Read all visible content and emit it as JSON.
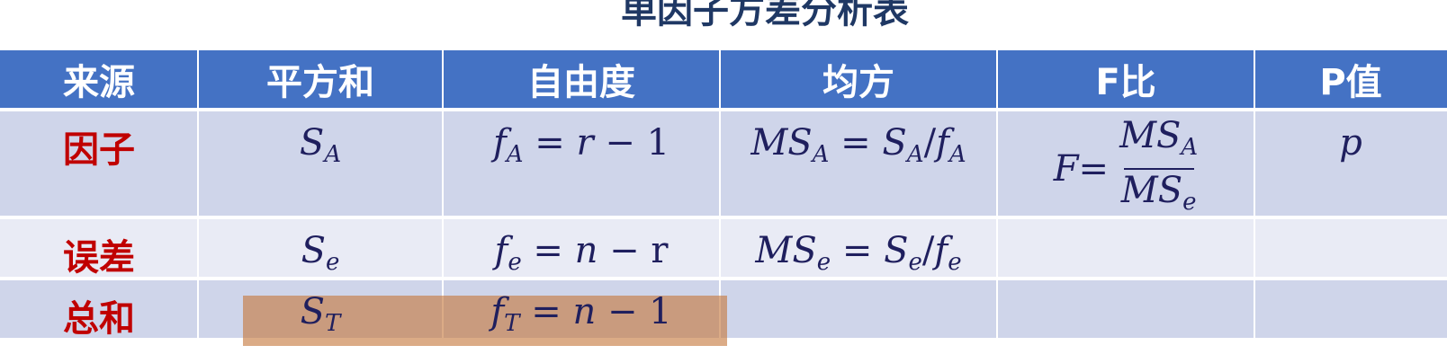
{
  "title": "单因子方差分析表",
  "headers": [
    "来源",
    "平方和",
    "自由度",
    "均方",
    "F比",
    "P值"
  ],
  "rows": [
    {
      "source": "因子",
      "sum_sq": {
        "base": "S",
        "sub": "A"
      },
      "df": {
        "lhs_base": "f",
        "lhs_sub": "A",
        "eq": " = ",
        "rhs_var": "r",
        "rhs_rest": " − 1"
      },
      "ms": {
        "b1": "MS",
        "s1": "A",
        "eq": " = ",
        "b2": "S",
        "s2": "A",
        "slash": "/",
        "b3": "f",
        "s3": "A"
      },
      "f_ratio": {
        "lhs": "F",
        "eq": " = ",
        "num_base": "MS",
        "num_sub": "A",
        "den_base": "MS",
        "den_sub": "e"
      },
      "p_value": "p"
    },
    {
      "source": "误差",
      "sum_sq": {
        "base": "S",
        "sub": "e"
      },
      "df": {
        "lhs_base": "f",
        "lhs_sub": "e",
        "eq": " = ",
        "rhs_var": "n",
        "rhs_rest": " − r"
      },
      "ms": {
        "b1": "MS",
        "s1": "e",
        "eq": " = ",
        "b2": "S",
        "s2": "e",
        "slash": "/",
        "b3": "f",
        "s3": "e"
      }
    },
    {
      "source": "总和",
      "sum_sq": {
        "base": "S",
        "sub": "T"
      },
      "df": {
        "lhs_base": "f",
        "lhs_sub": "T",
        "eq": " = ",
        "rhs_var": "n",
        "rhs_rest": " − 1"
      }
    }
  ],
  "colors": {
    "header_bg": "#4472c4",
    "row_dark": "#cfd5ea",
    "row_light": "#e9ebf5",
    "source_text": "#c00000",
    "title_text": "#1f3864",
    "highlight": "#c5783c"
  }
}
